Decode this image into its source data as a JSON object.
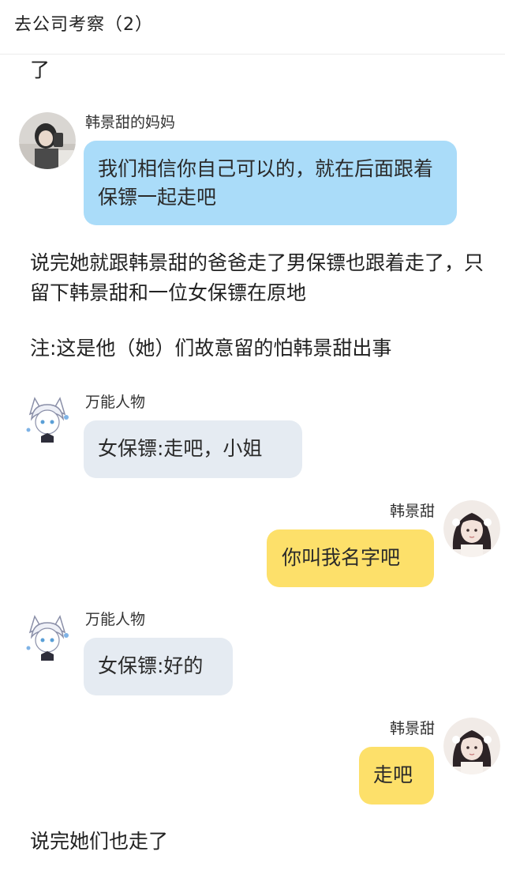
{
  "header": {
    "title": "去公司考察（2）"
  },
  "narration": {
    "top_fragment": "了",
    "line1": "说完她就跟韩景甜的爸爸走了男保镖也跟着走了，只留下韩景甜和一位女保镖在原地",
    "note": "注:这是他（她）们故意留的怕韩景甜出事",
    "ending": "说完她们也走了"
  },
  "messages": [
    {
      "sender": "韩景甜的妈妈",
      "side": "left",
      "avatar": "mother-avatar",
      "text": "我们相信你自己可以的，就在后面跟着保镖一起走吧",
      "color": "#aadcf9"
    },
    {
      "sender": "万能人物",
      "side": "left",
      "avatar": "anime-character-avatar",
      "text": "女保镖:走吧，小姐",
      "color": "#e5ebf2"
    },
    {
      "sender": "韩景甜",
      "side": "right",
      "avatar": "girl-avatar",
      "text": "你叫我名字吧",
      "color": "#fde06a"
    },
    {
      "sender": "万能人物",
      "side": "left",
      "avatar": "anime-character-avatar",
      "text": "女保镖:好的",
      "color": "#e5ebf2"
    },
    {
      "sender": "韩景甜",
      "side": "right",
      "avatar": "girl-avatar",
      "text": "走吧",
      "color": "#fde06a"
    }
  ]
}
